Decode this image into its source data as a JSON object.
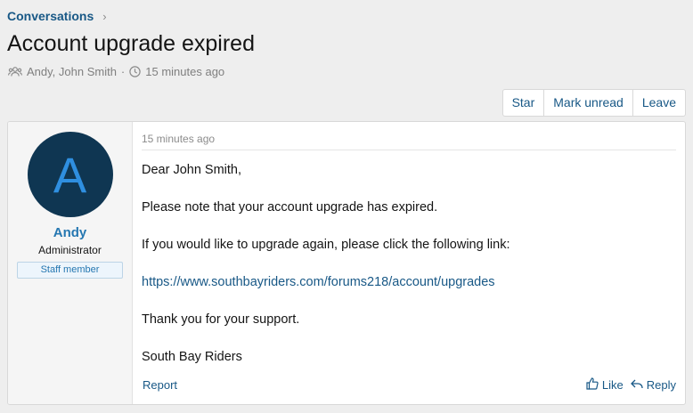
{
  "breadcrumb": {
    "label": "Conversations",
    "chevron": "›"
  },
  "title": "Account upgrade expired",
  "meta": {
    "participants": "Andy, John Smith",
    "separator": "·",
    "time": "15 minutes ago"
  },
  "actions": {
    "star": "Star",
    "mark_unread": "Mark unread",
    "leave": "Leave"
  },
  "author": {
    "avatar_letter": "A",
    "name": "Andy",
    "title": "Administrator",
    "badge": "Staff member"
  },
  "post": {
    "date": "15 minutes ago",
    "greeting": "Dear John Smith,",
    "line1": "Please note that your account upgrade has expired.",
    "line2": "If you would like to upgrade again, please click the following link:",
    "link": "https://www.southbayriders.com/forums218/account/upgrades",
    "line3": "Thank you for your support.",
    "signature": "South Bay Riders"
  },
  "footer": {
    "report": "Report",
    "like": "Like",
    "reply": "Reply"
  }
}
